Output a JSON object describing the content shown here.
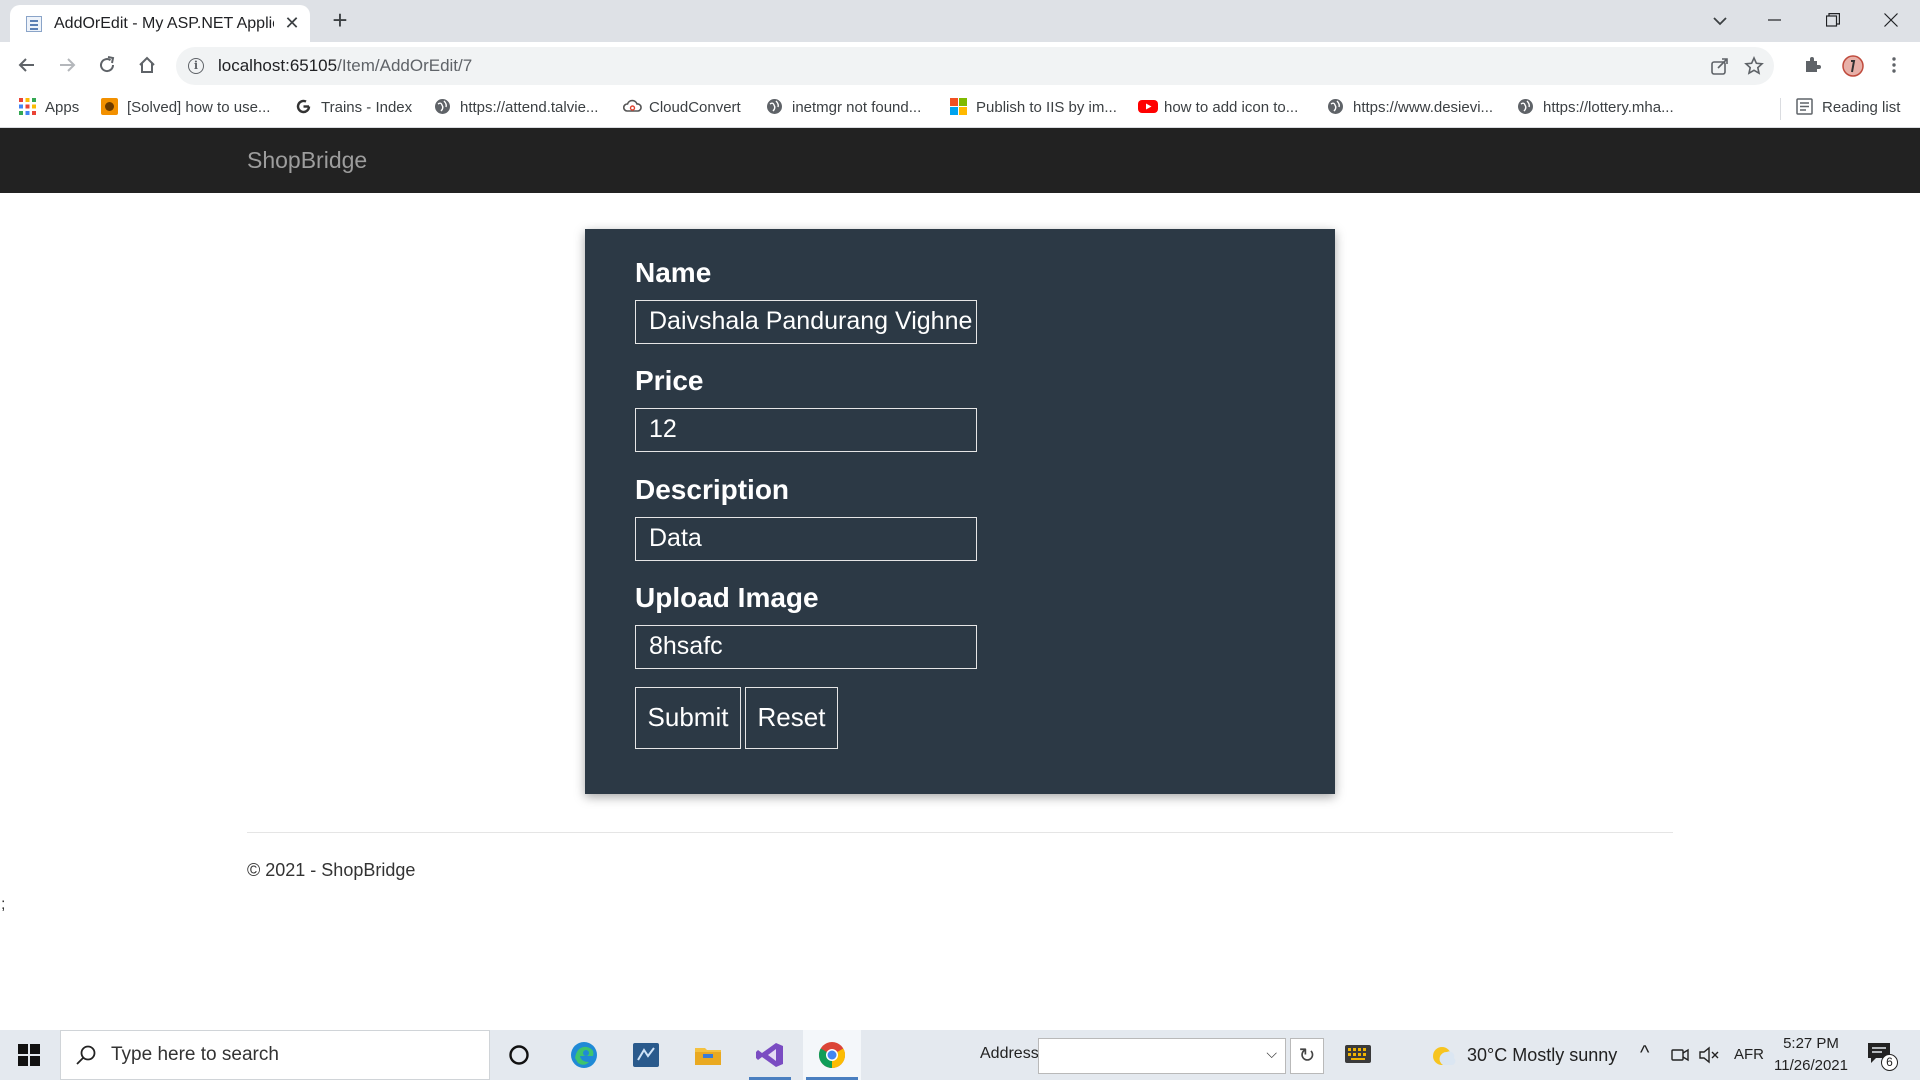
{
  "browser": {
    "tab": {
      "title": "AddOrEdit - My ASP.NET Application"
    },
    "url": {
      "host": "localhost:65105",
      "path": "/Item/AddOrEdit/7"
    },
    "bookmarks": [
      {
        "label": "Apps",
        "icon": "apps-grid-icon"
      },
      {
        "label": "[Solved] how to use...",
        "icon": "codeproject-icon"
      },
      {
        "label": "Trains - Index",
        "icon": "trains-icon"
      },
      {
        "label": "https://attend.talvie...",
        "icon": "globe-icon"
      },
      {
        "label": "CloudConvert",
        "icon": "cloudconvert-icon"
      },
      {
        "label": "inetmgr not found...",
        "icon": "globe-icon"
      },
      {
        "label": "Publish to IIS by im...",
        "icon": "microsoft-icon"
      },
      {
        "label": "how to add icon to...",
        "icon": "youtube-icon"
      },
      {
        "label": "https://www.desievi...",
        "icon": "globe-icon"
      },
      {
        "label": "https://lottery.mha...",
        "icon": "globe-icon"
      }
    ],
    "reading_list": "Reading list"
  },
  "page": {
    "brand": "ShopBridge",
    "form": {
      "name_label": "Name",
      "name_value": "Daivshala Pandurang Vighne",
      "price_label": "Price",
      "price_value": "12",
      "description_label": "Description",
      "description_value": "Data",
      "image_label": "Upload Image",
      "image_value": "8hsafc",
      "submit_label": "Submit",
      "reset_label": "Reset"
    },
    "footer": "© 2021 - ShopBridge",
    "stray_text": ";"
  },
  "taskbar": {
    "search_placeholder": "Type here to search",
    "address_label": "Address",
    "weather": "30°C  Mostly sunny",
    "language": "AFR",
    "time": "5:27 PM",
    "date": "11/26/2021",
    "notification_count": "6"
  },
  "colors": {
    "navbar": "#222222",
    "brand": "#9d9d9d",
    "panel": "#2c3945",
    "panel_text": "#ffffff"
  }
}
